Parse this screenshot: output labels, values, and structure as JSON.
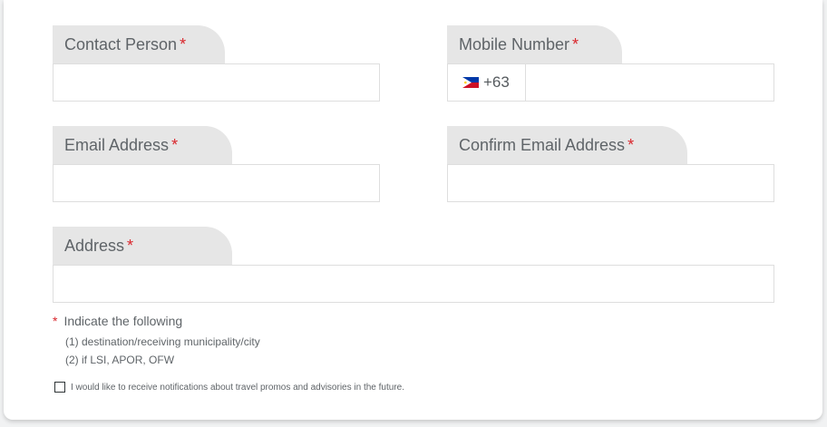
{
  "form": {
    "contact_person": {
      "label": "Contact Person",
      "required_mark": "*",
      "value": ""
    },
    "mobile_number": {
      "label": "Mobile Number",
      "required_mark": "*",
      "country_code": "+63",
      "flag": "philippines-flag-icon",
      "value": ""
    },
    "email_address": {
      "label": "Email Address",
      "required_mark": "*",
      "value": ""
    },
    "confirm_email_address": {
      "label": "Confirm Email Address",
      "required_mark": "*",
      "value": ""
    },
    "address": {
      "label": "Address",
      "required_mark": "*",
      "value": ""
    }
  },
  "note": {
    "required_mark": "*",
    "heading": "Indicate the following",
    "line1": "(1) destination/receiving municipality/city",
    "line2": "(2) if LSI, APOR, OFW"
  },
  "consent": {
    "label": "I would like to receive notifications about travel promos and advisories in the future.",
    "checked": false
  },
  "colors": {
    "tab_background": "#e6e6e6",
    "required": "#d9262c",
    "label_text": "#5f6468",
    "border": "#dedede"
  }
}
